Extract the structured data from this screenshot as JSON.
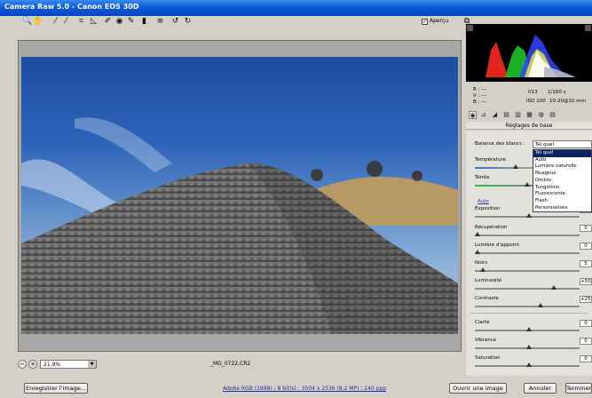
{
  "window": {
    "title": "Camera Raw 5.0  -  Canon EOS 30D"
  },
  "toolbar": {
    "tools": [
      "zoom-icon",
      "hand-icon",
      "eyedropper-icon",
      "color-sampler-icon",
      "crop-icon",
      "straighten-icon",
      "spot-removal-icon",
      "red-eye-icon",
      "brush-icon",
      "gradient-icon",
      "prefs-icon",
      "rotate-left-icon",
      "rotate-right-icon"
    ],
    "tool_glyphs": [
      "🔍",
      "✋",
      "⁄",
      "⁄",
      "⌗",
      "◺",
      "✐",
      "◉",
      "✎",
      "▮",
      "≡",
      "↺",
      "↻"
    ],
    "preview_label": "Aperçu",
    "preview_checked": true,
    "fullscreen_glyph": "⧉"
  },
  "preview": {
    "zoom_value": "21.9%",
    "filename": "_MG_0722.CR2"
  },
  "histogram": {
    "rgb_labels": [
      "R :  ---",
      "V :  ---",
      "B :  ---"
    ],
    "aperture": "f/13",
    "shutter": "1/160 s",
    "iso": "ISO 100",
    "lens": "10-20@10 mm"
  },
  "panel": {
    "title": "Réglages de base",
    "tab_glyphs": [
      "◉",
      "⊿",
      "◢",
      "▤",
      "▥",
      "▦",
      "◍",
      "▤"
    ],
    "white_balance_label": "Balance des blancs :",
    "white_balance_value": "Tel quel",
    "white_balance_options": [
      "Tel quel",
      "Auto",
      "Lumière naturelle",
      "Nuageux",
      "Ombre",
      "Tungstène",
      "Fluorescente",
      "Flash",
      "Personnalisée"
    ],
    "white_balance_selected_index": 0,
    "temperature_label": "Température",
    "tint_label": "Teinte",
    "auto_label": "Auto",
    "sliders": [
      {
        "label": "Exposition",
        "value": "0.00",
        "pos": 0.5
      },
      {
        "label": "Récupération",
        "value": "0",
        "pos": 0
      },
      {
        "label": "Lumière d'appoint",
        "value": "0",
        "pos": 0
      },
      {
        "label": "Noirs",
        "value": "5",
        "pos": 0.05
      },
      {
        "label": "Luminosité",
        "value": "+50",
        "pos": 0.75
      },
      {
        "label": "Contraste",
        "value": "+25",
        "pos": 0.62
      },
      {
        "label": "Clarté",
        "value": "0",
        "pos": 0.5
      },
      {
        "label": "Vibrance",
        "value": "0",
        "pos": 0.5
      },
      {
        "label": "Saturation",
        "value": "0",
        "pos": 0.5
      }
    ]
  },
  "footer": {
    "save_button": "Enregistrer l'image...",
    "workflow_link": "Adobe RGB (1998) ; 8 bit(s) ; 3504 x 2336 (8,2 MP) ; 240 ppp",
    "open_button": "Ouvrir une image",
    "cancel_button": "Annuler",
    "done_button": "Terminer"
  },
  "colors": {
    "titlebar": "#0a5ad6",
    "selection": "#0a246a",
    "link": "#1b2fb0"
  }
}
